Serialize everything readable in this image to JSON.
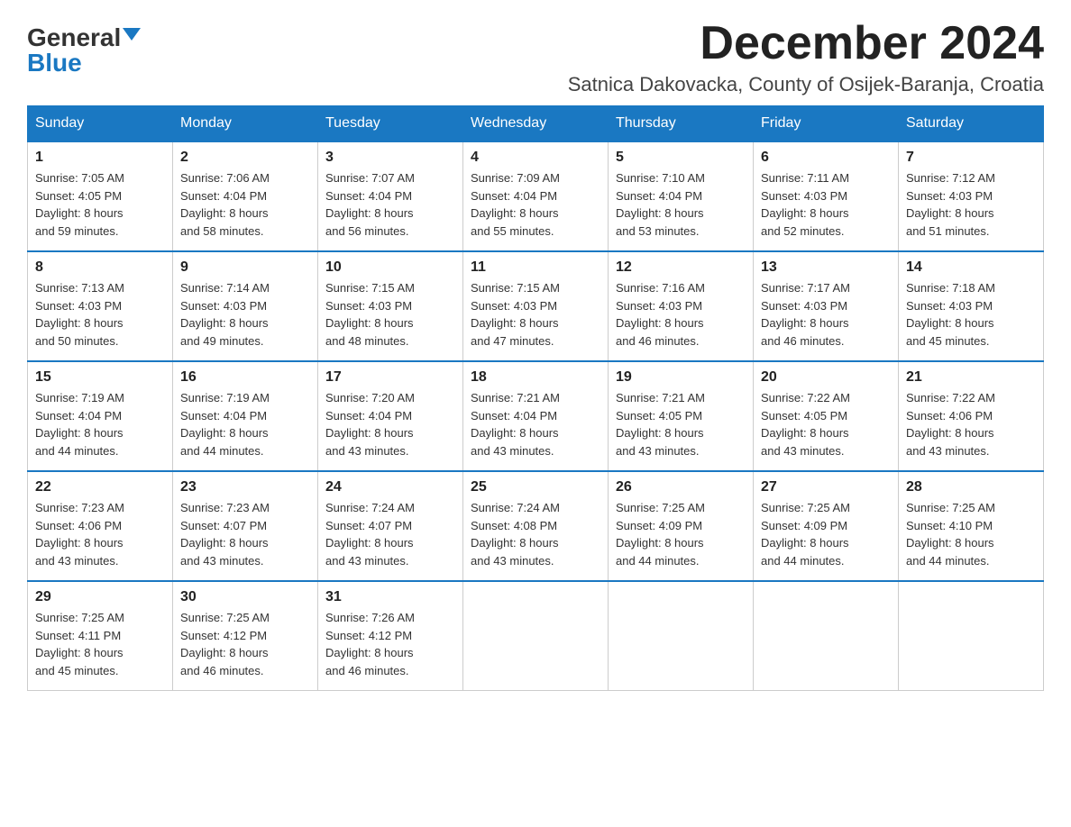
{
  "header": {
    "logo_general": "General",
    "logo_blue": "Blue",
    "month_title": "December 2024",
    "location": "Satnica Dakovacka, County of Osijek-Baranja, Croatia"
  },
  "days_of_week": [
    "Sunday",
    "Monday",
    "Tuesday",
    "Wednesday",
    "Thursday",
    "Friday",
    "Saturday"
  ],
  "weeks": [
    [
      {
        "day": "1",
        "sunrise": "7:05 AM",
        "sunset": "4:05 PM",
        "daylight": "8 hours and 59 minutes."
      },
      {
        "day": "2",
        "sunrise": "7:06 AM",
        "sunset": "4:04 PM",
        "daylight": "8 hours and 58 minutes."
      },
      {
        "day": "3",
        "sunrise": "7:07 AM",
        "sunset": "4:04 PM",
        "daylight": "8 hours and 56 minutes."
      },
      {
        "day": "4",
        "sunrise": "7:09 AM",
        "sunset": "4:04 PM",
        "daylight": "8 hours and 55 minutes."
      },
      {
        "day": "5",
        "sunrise": "7:10 AM",
        "sunset": "4:04 PM",
        "daylight": "8 hours and 53 minutes."
      },
      {
        "day": "6",
        "sunrise": "7:11 AM",
        "sunset": "4:03 PM",
        "daylight": "8 hours and 52 minutes."
      },
      {
        "day": "7",
        "sunrise": "7:12 AM",
        "sunset": "4:03 PM",
        "daylight": "8 hours and 51 minutes."
      }
    ],
    [
      {
        "day": "8",
        "sunrise": "7:13 AM",
        "sunset": "4:03 PM",
        "daylight": "8 hours and 50 minutes."
      },
      {
        "day": "9",
        "sunrise": "7:14 AM",
        "sunset": "4:03 PM",
        "daylight": "8 hours and 49 minutes."
      },
      {
        "day": "10",
        "sunrise": "7:15 AM",
        "sunset": "4:03 PM",
        "daylight": "8 hours and 48 minutes."
      },
      {
        "day": "11",
        "sunrise": "7:15 AM",
        "sunset": "4:03 PM",
        "daylight": "8 hours and 47 minutes."
      },
      {
        "day": "12",
        "sunrise": "7:16 AM",
        "sunset": "4:03 PM",
        "daylight": "8 hours and 46 minutes."
      },
      {
        "day": "13",
        "sunrise": "7:17 AM",
        "sunset": "4:03 PM",
        "daylight": "8 hours and 46 minutes."
      },
      {
        "day": "14",
        "sunrise": "7:18 AM",
        "sunset": "4:03 PM",
        "daylight": "8 hours and 45 minutes."
      }
    ],
    [
      {
        "day": "15",
        "sunrise": "7:19 AM",
        "sunset": "4:04 PM",
        "daylight": "8 hours and 44 minutes."
      },
      {
        "day": "16",
        "sunrise": "7:19 AM",
        "sunset": "4:04 PM",
        "daylight": "8 hours and 44 minutes."
      },
      {
        "day": "17",
        "sunrise": "7:20 AM",
        "sunset": "4:04 PM",
        "daylight": "8 hours and 43 minutes."
      },
      {
        "day": "18",
        "sunrise": "7:21 AM",
        "sunset": "4:04 PM",
        "daylight": "8 hours and 43 minutes."
      },
      {
        "day": "19",
        "sunrise": "7:21 AM",
        "sunset": "4:05 PM",
        "daylight": "8 hours and 43 minutes."
      },
      {
        "day": "20",
        "sunrise": "7:22 AM",
        "sunset": "4:05 PM",
        "daylight": "8 hours and 43 minutes."
      },
      {
        "day": "21",
        "sunrise": "7:22 AM",
        "sunset": "4:06 PM",
        "daylight": "8 hours and 43 minutes."
      }
    ],
    [
      {
        "day": "22",
        "sunrise": "7:23 AM",
        "sunset": "4:06 PM",
        "daylight": "8 hours and 43 minutes."
      },
      {
        "day": "23",
        "sunrise": "7:23 AM",
        "sunset": "4:07 PM",
        "daylight": "8 hours and 43 minutes."
      },
      {
        "day": "24",
        "sunrise": "7:24 AM",
        "sunset": "4:07 PM",
        "daylight": "8 hours and 43 minutes."
      },
      {
        "day": "25",
        "sunrise": "7:24 AM",
        "sunset": "4:08 PM",
        "daylight": "8 hours and 43 minutes."
      },
      {
        "day": "26",
        "sunrise": "7:25 AM",
        "sunset": "4:09 PM",
        "daylight": "8 hours and 44 minutes."
      },
      {
        "day": "27",
        "sunrise": "7:25 AM",
        "sunset": "4:09 PM",
        "daylight": "8 hours and 44 minutes."
      },
      {
        "day": "28",
        "sunrise": "7:25 AM",
        "sunset": "4:10 PM",
        "daylight": "8 hours and 44 minutes."
      }
    ],
    [
      {
        "day": "29",
        "sunrise": "7:25 AM",
        "sunset": "4:11 PM",
        "daylight": "8 hours and 45 minutes."
      },
      {
        "day": "30",
        "sunrise": "7:25 AM",
        "sunset": "4:12 PM",
        "daylight": "8 hours and 46 minutes."
      },
      {
        "day": "31",
        "sunrise": "7:26 AM",
        "sunset": "4:12 PM",
        "daylight": "8 hours and 46 minutes."
      },
      null,
      null,
      null,
      null
    ]
  ]
}
